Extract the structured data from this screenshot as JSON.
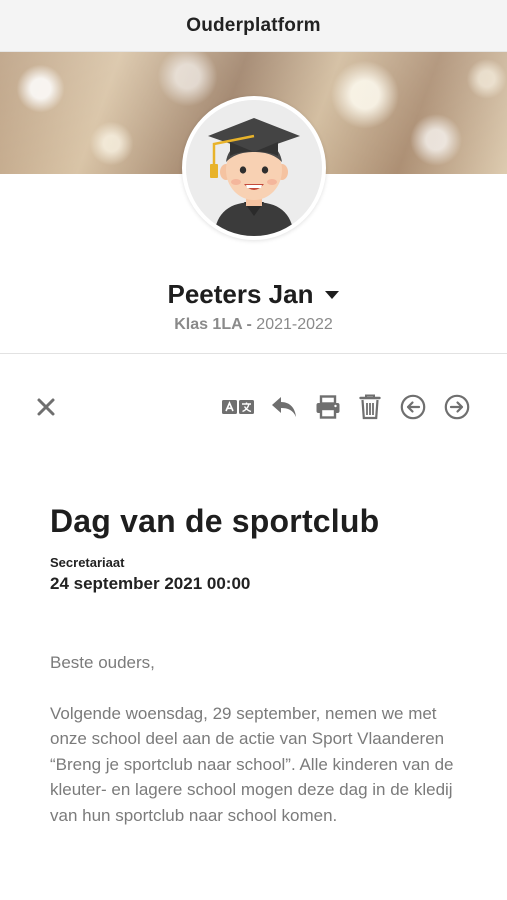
{
  "app": {
    "title": "Ouderplatform"
  },
  "profile": {
    "name": "Peeters Jan",
    "class_label": "Klas 1LA -",
    "school_year": "2021-2022"
  },
  "toolbar": {
    "close_icon": "close-icon",
    "translate_icon": "translate-icon",
    "reply_icon": "reply-icon",
    "print_icon": "print-icon",
    "delete_icon": "trash-icon",
    "previous_icon": "arrow-left-circle-icon",
    "next_icon": "arrow-right-circle-icon"
  },
  "message": {
    "title": "Dag van de sportclub",
    "sender": "Secretariaat",
    "date": "24 september 2021 00:00",
    "greeting": "Beste ouders,",
    "body": "Volgende woensdag, 29 september, nemen we met onze school deel aan de actie van Sport Vlaanderen “Breng je sportclub naar school”. Alle kinderen van de kleuter- en lagere school mogen deze dag in de kledij van hun sportclub naar school komen."
  },
  "colors": {
    "accent_text": "#1e1e1e",
    "muted_text": "#7b7b7b",
    "icon_gray": "#6f6f6f",
    "topbar_bg": "#f4f4f4"
  }
}
